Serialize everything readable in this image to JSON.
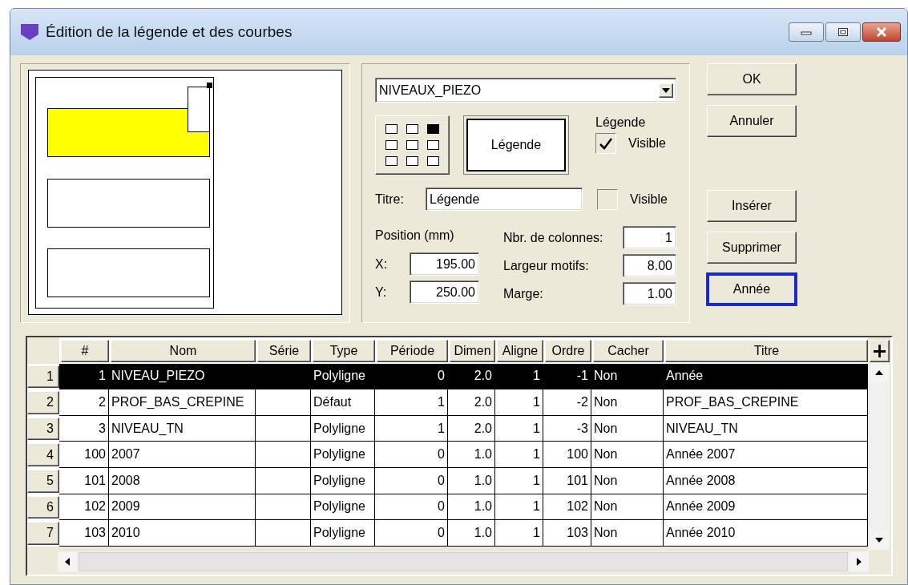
{
  "window": {
    "title": "Édition de la légende et des courbes"
  },
  "curve_set": {
    "value": "NIVEAUX_PIEZO"
  },
  "anchor_positions": [
    {
      "selected": false
    },
    {
      "selected": false
    },
    {
      "selected": true
    },
    {
      "selected": false
    },
    {
      "selected": false
    },
    {
      "selected": false
    },
    {
      "selected": false
    },
    {
      "selected": false
    },
    {
      "selected": false
    }
  ],
  "legend_preview_button": "Légende",
  "legend_group": {
    "label": "Légende",
    "visible": {
      "label": "Visible",
      "checked": true
    }
  },
  "title_field": {
    "label": "Titre:",
    "value": "Légende",
    "visible": {
      "label": "Visible",
      "checked": false
    }
  },
  "position": {
    "label": "Position (mm)",
    "x": {
      "label": "X:",
      "value": "195.00"
    },
    "y": {
      "label": "Y:",
      "value": "250.00"
    }
  },
  "layout_fields": [
    {
      "label": "Nbr. de colonnes:",
      "value": "1"
    },
    {
      "label": "Largeur motifs:",
      "value": "8.00"
    },
    {
      "label": "Marge:",
      "value": "1.00"
    }
  ],
  "dialog_buttons": [
    {
      "label": "OK",
      "focused": false
    },
    {
      "label": "Annuler",
      "focused": false
    }
  ],
  "row_buttons": [
    {
      "label": "Insérer",
      "focused": false
    },
    {
      "label": "Supprimer",
      "focused": false
    },
    {
      "label": "Année",
      "focused": true
    }
  ],
  "table": {
    "columns": [
      {
        "label": "#"
      },
      {
        "label": "Nom"
      },
      {
        "label": "Série"
      },
      {
        "label": "Type"
      },
      {
        "label": "Période"
      },
      {
        "label": "Dimen"
      },
      {
        "label": "Aligne"
      },
      {
        "label": "Ordre"
      },
      {
        "label": "Cacher"
      },
      {
        "label": "Titre"
      }
    ],
    "add_column_button": "+",
    "rows": [
      {
        "header": "1",
        "selected": true,
        "cells": [
          "1",
          "NIVEAU_PIEZO",
          null,
          "Polyligne",
          "0",
          "2.0",
          "1",
          "-1",
          "Non",
          "Année"
        ]
      },
      {
        "header": "2",
        "selected": false,
        "cells": [
          "2",
          "PROF_BAS_CREPINE",
          null,
          "Défaut",
          "1",
          "2.0",
          "1",
          "-2",
          "Non",
          "PROF_BAS_CREPINE"
        ]
      },
      {
        "header": "3",
        "selected": false,
        "cells": [
          "3",
          "NIVEAU_TN",
          null,
          "Polyligne",
          "1",
          "2.0",
          "1",
          "-3",
          "Non",
          "NIVEAU_TN"
        ]
      },
      {
        "header": "4",
        "selected": false,
        "cells": [
          "100",
          "2007",
          null,
          "Polyligne",
          "0",
          "1.0",
          "1",
          "100",
          "Non",
          "Année 2007"
        ]
      },
      {
        "header": "5",
        "selected": false,
        "cells": [
          "101",
          "2008",
          null,
          "Polyligne",
          "0",
          "1.0",
          "1",
          "101",
          "Non",
          "Année 2008"
        ]
      },
      {
        "header": "6",
        "selected": false,
        "cells": [
          "102",
          "2009",
          null,
          "Polyligne",
          "0",
          "1.0",
          "1",
          "102",
          "Non",
          "Année 2009"
        ]
      },
      {
        "header": "7",
        "selected": false,
        "cells": [
          "103",
          "2010",
          null,
          "Polyligne",
          "0",
          "1.0",
          "1",
          "103",
          "Non",
          "Année 2010"
        ]
      }
    ]
  }
}
